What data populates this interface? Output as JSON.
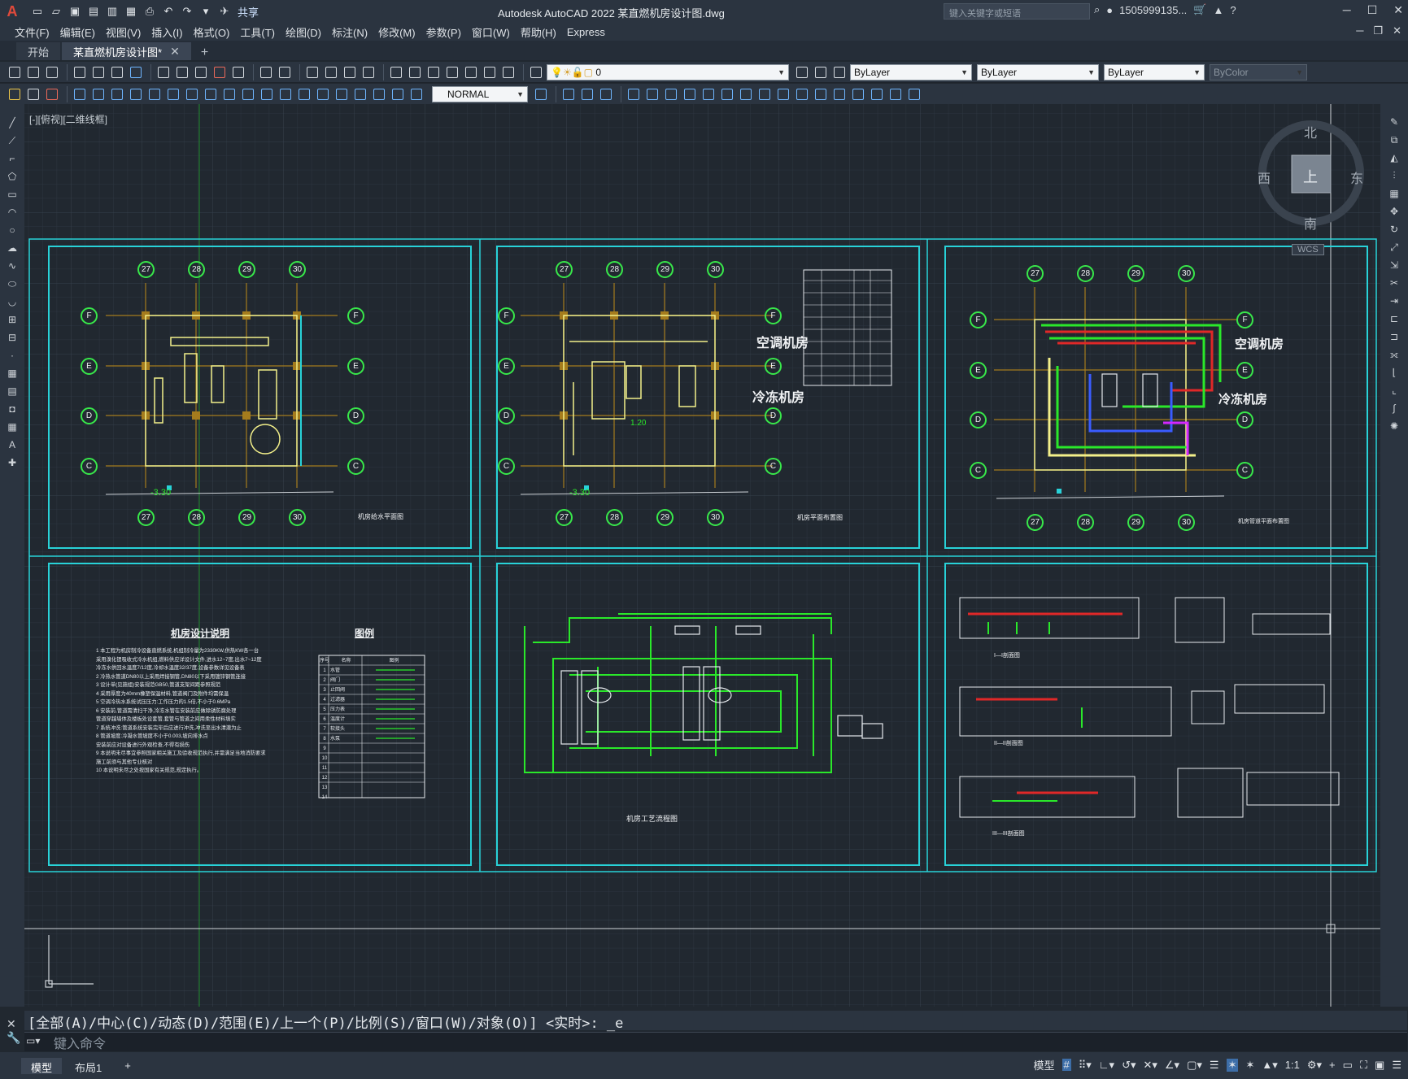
{
  "titlebar": {
    "logo": "A",
    "share_label": "共享",
    "app_title": "Autodesk AutoCAD 2022    某直燃机房设计图.dwg",
    "search_placeholder": "键入关键字或短语",
    "user": "1505999135...",
    "win_min": "─",
    "win_max": "☐",
    "win_close": "✕"
  },
  "menubar": {
    "items": [
      "文件(F)",
      "编辑(E)",
      "视图(V)",
      "插入(I)",
      "格式(O)",
      "工具(T)",
      "绘图(D)",
      "标注(N)",
      "修改(M)",
      "参数(P)",
      "窗口(W)",
      "帮助(H)",
      "Express"
    ]
  },
  "filetabs": {
    "start": "开始",
    "active": "某直燃机房设计图*"
  },
  "toolbar": {
    "layer_value": "0",
    "color_value": "ByLayer",
    "linetype_value": "ByLayer",
    "lineweight_value": "ByLayer",
    "plotstyle_value": "ByColor",
    "dimstyle_value": "NORMAL"
  },
  "viewport": {
    "label": "[-][俯视][二维线框]",
    "compass": {
      "north": "北",
      "south": "南",
      "east": "东",
      "west": "西",
      "top": "上",
      "wcs": "WCS"
    },
    "sheets": {
      "s1_title": "机房给水平面图",
      "s2_title": "机房平面布置图",
      "s3_title": "机房管道平面布置图",
      "s5_title": "机房工艺流程图",
      "room_ac": "空调机房",
      "room_chill": "冷冻机房",
      "notes_title": "机房设计说明",
      "legend_title": "图例",
      "section_1": "I—I剖面图",
      "section_2": "II—II剖面图",
      "section_3": "III—III剖面图",
      "grid_cols": [
        "27",
        "28",
        "29",
        "30"
      ],
      "grid_rows": [
        "F",
        "E",
        "D",
        "C"
      ],
      "level_1": "-3.30",
      "level_2": "-3.30",
      "level_3": "1.20",
      "notes_lines": [
        "1  本工程为机房制冷设备直燃系统,机组制冷量为2330KW,供热KW各一台",
        "   采用溴化锂吸收式冷水机组,燃料供应详设计文件,进水12~7度,出水7~12度",
        "   冷冻水供回水温度7/12度,冷却水温度32/37度,设备参数详见设备表",
        "2  冷热水管道DN80以上采用焊接钢管,DN80以下采用镀锌钢管连接",
        "3  设计单(见施组)安装规范GB50,管道支架间距参照规范",
        "4  采用厚度为40mm橡塑保温材料,管道阀门及附件均需保温",
        "5  空调冷热水系统试压压力:工作压力的1.5倍,不小于0.6MPa",
        "6  安装前,管道需清扫干净,冷冻水管在安装前应做除锈防腐处理",
        "   管道穿越墙体及楼板处设套管,套管与管道之间用柔性材料填实",
        "7  系统冲洗:管道系统安装完毕后应进行冲洗,冲洗至出水清澈为止",
        "8  管道坡度:冷凝水管坡度不小于0.003,坡向排水点",
        "   安装前应对设备进行外观检查,不得有损伤",
        "9  本说明未尽事宜参照国家相关施工及验收规范执行,并需满足当地消防要求",
        "   施工前须与其他专业核对",
        "10 本说明未尽之处按国家有关规范,规定执行。"
      ],
      "legend_header": [
        "序号",
        "名称",
        "图例"
      ],
      "legend_rows": [
        "1",
        "2",
        "3",
        "4",
        "5",
        "6",
        "7",
        "8",
        "9",
        "10",
        "11",
        "12",
        "13",
        "14"
      ],
      "legend_names": [
        "水管",
        "阀门",
        "止回阀",
        "过滤器",
        "压力表",
        "温度计",
        "软接头",
        "水泵"
      ]
    }
  },
  "command": {
    "history": "[全部(A)/中心(C)/动态(D)/范围(E)/上一个(P)/比例(S)/窗口(W)/对象(O)] <实时>: _e",
    "placeholder": "键入命令"
  },
  "statusbar": {
    "layout_model": "模型",
    "layout_1": "布局1",
    "add": "+",
    "model_btn": "模型",
    "scale": "1:1"
  },
  "colors": {
    "sheet_frame": "#28d2d8",
    "grid_bubble": "#38e84a",
    "column": "#a57c1d",
    "wall": "#f3f08a",
    "hot_pipe": "#e02828",
    "cold_pipe": "#2ae82a",
    "blue_pipe": "#3a5cff",
    "magenta_pipe": "#d428ff"
  }
}
